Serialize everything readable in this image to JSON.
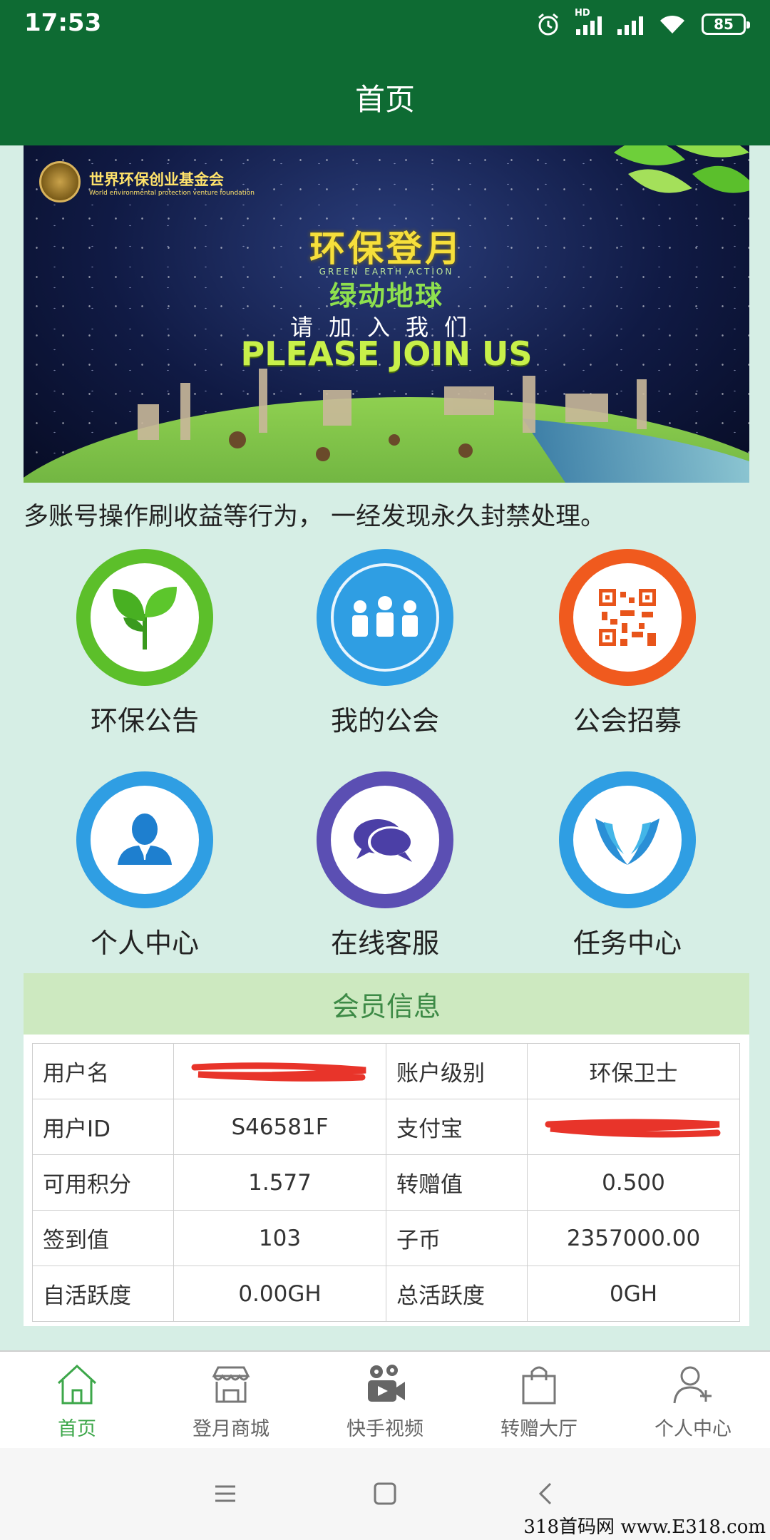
{
  "status_bar": {
    "time": "17:53",
    "network_badge": "HD",
    "battery": "85"
  },
  "header": {
    "title": "首页"
  },
  "banner": {
    "org_name": "世界环保创业基金会",
    "org_name_en": "World environmental protection venture foundation",
    "headline": "环保登月",
    "sub_en": "GREEN EARTH ACTION",
    "slogan": "绿动地球",
    "invite_cn": "请加入我们",
    "invite_en": "PLEASE JOIN US"
  },
  "notice": "多账号操作刷收益等行为， 一经发现永久封禁处理。",
  "menu": [
    {
      "label": "环保公告",
      "icon": "sprout-icon",
      "color": "#5cbf2a"
    },
    {
      "label": "我的公会",
      "icon": "group-icon",
      "color": "#2f9ee3"
    },
    {
      "label": "公会招募",
      "icon": "qr-code-icon",
      "color": "#f05a1e"
    },
    {
      "label": "个人中心",
      "icon": "person-icon",
      "color": "#2f9ee3"
    },
    {
      "label": "在线客服",
      "icon": "chat-icon",
      "color": "#5b4fb3"
    },
    {
      "label": "任务中心",
      "icon": "hands-icon",
      "color": "#2f9ee3"
    }
  ],
  "member_info": {
    "title": "会员信息",
    "rows": [
      {
        "k1": "用户名",
        "v1": "",
        "k2": "账户级别",
        "v2": "环保卫士"
      },
      {
        "k1": "用户ID",
        "v1": "S46581F",
        "k2": "支付宝",
        "v2": ""
      },
      {
        "k1": "可用积分",
        "v1": "1.577",
        "k2": "转赠值",
        "v2": "0.500"
      },
      {
        "k1": "签到值",
        "v1": "103",
        "k2": "子币",
        "v2": "2357000.00"
      },
      {
        "k1": "自活跃度",
        "v1": "0.00GH",
        "k2": "总活跃度",
        "v2": "0GH"
      }
    ]
  },
  "tabs": [
    {
      "label": "首页",
      "icon": "home-icon",
      "active": true
    },
    {
      "label": "登月商城",
      "icon": "store-icon",
      "active": false
    },
    {
      "label": "快手视频",
      "icon": "video-camera-icon",
      "active": false
    },
    {
      "label": "转赠大厅",
      "icon": "shopping-bag-icon",
      "active": false
    },
    {
      "label": "个人中心",
      "icon": "add-user-icon",
      "active": false
    }
  ],
  "watermark": "318首码网 www.E318.com",
  "colors": {
    "primary": "#0e6b33",
    "background": "#d6eee5",
    "active_tab": "#3da74a",
    "member_header": "#cde9c0"
  }
}
